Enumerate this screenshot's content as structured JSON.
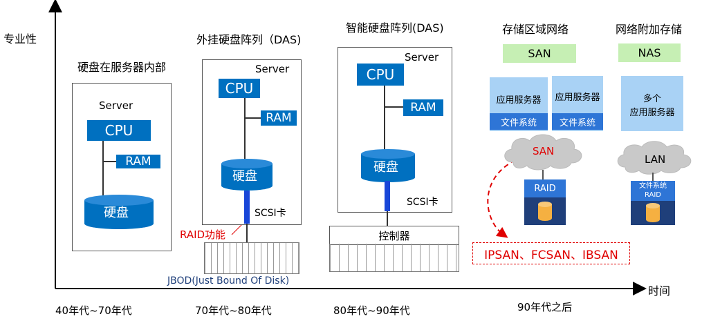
{
  "axes": {
    "y_label": "专业性",
    "x_label": "时间"
  },
  "eras": [
    "40年代~70年代",
    "70年代~80年代",
    "80年代~90年代",
    "90年代之后"
  ],
  "stage1": {
    "title": "硬盘在服务器内部",
    "server": "Server",
    "cpu": "CPU",
    "ram": "RAM",
    "disk": "硬盘"
  },
  "stage2": {
    "title": "外挂硬盘阵列（DAS)",
    "server": "Server",
    "cpu": "CPU",
    "ram": "RAM",
    "disk": "硬盘",
    "scsi": "SCSI卡",
    "raid": "RAID功能",
    "jbod": "JBOD(Just Bound Of Disk)"
  },
  "stage3": {
    "title": "智能硬盘阵列(DAS)",
    "server": "Server",
    "cpu": "CPU",
    "ram": "RAM",
    "disk": "硬盘",
    "scsi": "SCSI卡",
    "controller": "控制器"
  },
  "stage4": {
    "san_title": "存储区域网络",
    "san_label": "SAN",
    "app_server": "应用服务器",
    "fs": "文件系统",
    "san_cloud": "SAN",
    "raid": "RAID",
    "types": "IPSAN、FCSAN、IBSAN",
    "nas_title": "网络附加存储",
    "nas_label": "NAS",
    "nas_servers_1": "多个",
    "nas_servers_2": "应用服务器",
    "lan_cloud": "LAN",
    "nas_fs": "文件系统",
    "nas_raid": "RAID"
  },
  "colors": {
    "blue": "#0070c0",
    "light_blue": "#a9d2f5",
    "fs_blue": "#2e75d6",
    "green": "#c6efb4",
    "red": "#e00000",
    "navy": "#1f3f7a",
    "cylinder_orange": "#f5b041"
  }
}
